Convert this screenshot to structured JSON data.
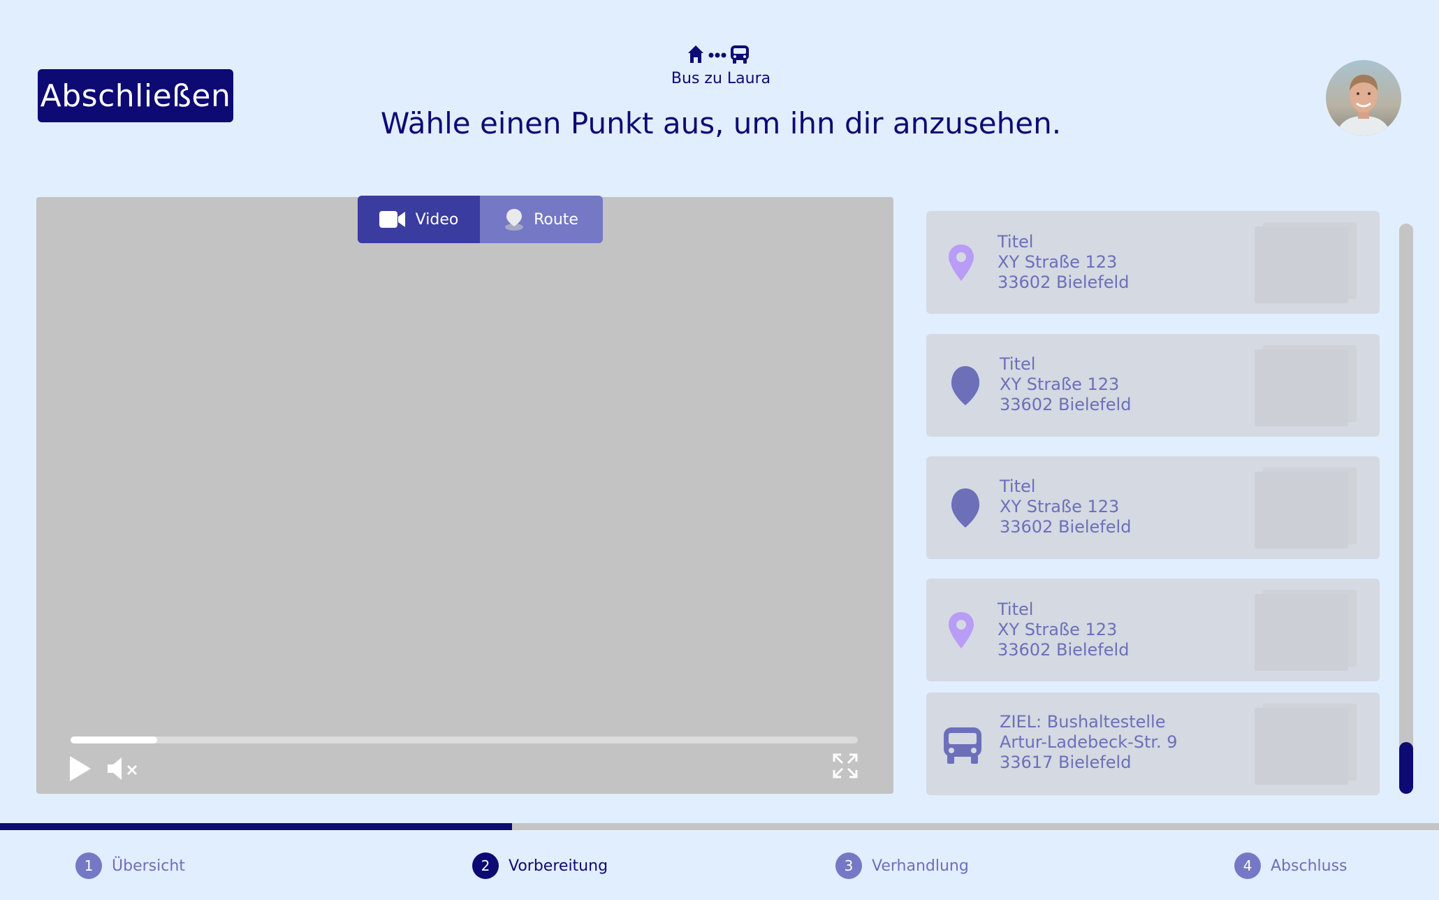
{
  "header": {
    "close_label": "Abschließen",
    "journey_label": "Bus zu Laura",
    "title": "Wähle einen Punkt aus, um ihn dir anzusehen."
  },
  "view_toggle": {
    "video_label": "Video",
    "route_label": "Route",
    "active": "Video"
  },
  "video": {
    "progress": 0.11,
    "muted": true
  },
  "locations": [
    {
      "title": "Titel",
      "street": "XY Straße 123",
      "city": "33602 Bielefeld",
      "icon": "location-pin-icon",
      "color": "#b89cf6"
    },
    {
      "title": "Titel",
      "street": "XY Straße 123",
      "city": "33602 Bielefeld",
      "icon": "drop-pin-icon",
      "color": "#6d6fb9"
    },
    {
      "title": "Titel",
      "street": "XY Straße 123",
      "city": "33602 Bielefeld",
      "icon": "drop-pin-icon",
      "color": "#6d6fb9"
    },
    {
      "title": "Titel",
      "street": "XY Straße 123",
      "city": "33602 Bielefeld",
      "icon": "location-pin-icon",
      "color": "#b89cf6"
    },
    {
      "title": "ZIEL: Bushaltestelle",
      "street": "Artur-Ladebeck-Str. 9",
      "city": "33617 Bielefeld",
      "icon": "bus-icon",
      "color": "#6d6fb9"
    }
  ],
  "steps": [
    {
      "number": "1",
      "label": "Übersicht"
    },
    {
      "number": "2",
      "label": "Vorbereitung"
    },
    {
      "number": "3",
      "label": "Verhandlung"
    },
    {
      "number": "4",
      "label": "Abschluss"
    }
  ],
  "active_step": 2,
  "colors": {
    "primary": "#0d0a73",
    "background": "#e1eefe",
    "muted_text": "#6d6fb9",
    "pin_light": "#b89cf6"
  }
}
